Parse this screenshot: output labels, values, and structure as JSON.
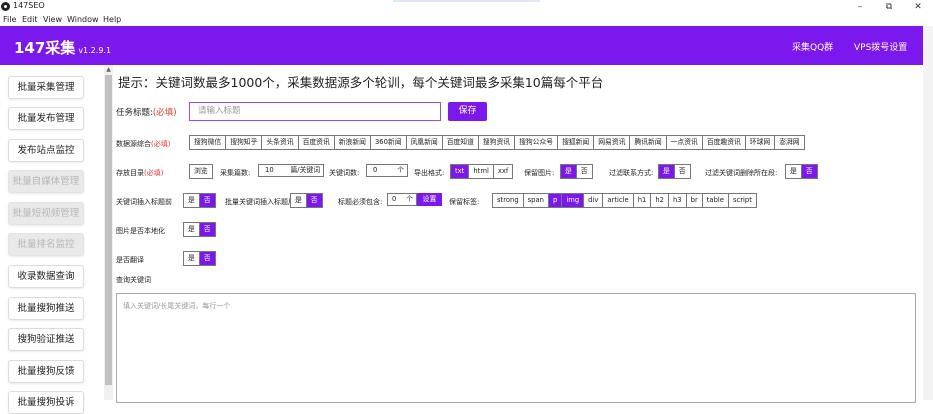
{
  "window": {
    "title": "147SEO",
    "minimize": "–",
    "maximize": "⧉",
    "close": "✕"
  },
  "menu": [
    "File",
    "Edit",
    "View",
    "Window",
    "Help"
  ],
  "header": {
    "logo": "147采集",
    "version": "v1.2.9.1",
    "links": [
      "采集QQ群",
      "VPS拨号设置"
    ]
  },
  "sidebar": {
    "items": [
      {
        "label": "批量采集管理",
        "disabled": false
      },
      {
        "label": "批量发布管理",
        "disabled": false
      },
      {
        "label": "发布站点监控",
        "disabled": false
      },
      {
        "label": "批量自媒体管理",
        "disabled": true
      },
      {
        "label": "批量短视频管理",
        "disabled": true
      },
      {
        "label": "批量排名监控",
        "disabled": true
      },
      {
        "label": "收录数据查询",
        "disabled": false
      },
      {
        "label": "批量搜狗推送",
        "disabled": false
      },
      {
        "label": "搜狗验证推送",
        "disabled": false
      },
      {
        "label": "批量搜狗反馈",
        "disabled": false
      },
      {
        "label": "批量搜狗投诉",
        "disabled": false
      }
    ]
  },
  "main": {
    "tip": "提示：关键词数最多1000个，采集数据源多个轮训，每个关键词最多采集10篇每个平台",
    "task": {
      "label": "任务标题:",
      "required": "(必填)",
      "placeholder": "请输入标题",
      "save": "保存"
    },
    "sources": {
      "label": "数据源综合",
      "required": "(必填)",
      "items": [
        "搜狗微信",
        "搜狗知乎",
        "头条资讯",
        "百度资讯",
        "新浪新闻",
        "360新闻",
        "凤凰新闻",
        "百度知道",
        "搜狗资讯",
        "搜狗公众号",
        "搜狐新闻",
        "网易资讯",
        "腾讯新闻",
        "一点资讯",
        "百度趣资讯",
        "环球网",
        "澎湃网"
      ]
    },
    "row3": {
      "dir_label": "存放目录",
      "dir_required": "(必填)",
      "browse": "浏览",
      "count_label": "采集篇数:",
      "count_value": "10",
      "count_unit": "篇/关键词",
      "kw_count_label": "关键词数:",
      "kw_count_value": "0",
      "kw_count_unit": "个",
      "export_label": "导出格式:",
      "export_formats": [
        "txt",
        "html",
        "xxf"
      ],
      "keep_img_label": "保留图片:",
      "filter_contact_label": "过滤联系方式:",
      "filter_kw_label": "过滤关键词删除所在段:",
      "yes": "是",
      "no": "否"
    },
    "row4": {
      "insert_title_label": "关键词插入标题前",
      "insert_title2_label": "批量关键词插入标题后:",
      "must_contain_label": "标题必须包含:",
      "must_contain_value": "0",
      "must_contain_unit": "个",
      "set_button": "设置",
      "keep_tags_label": "保留标签:",
      "tags": [
        "strong",
        "span",
        "p",
        "img",
        "div",
        "article",
        "h1",
        "h2",
        "h3",
        "br",
        "table",
        "script"
      ]
    },
    "localize_label": "图片是否本地化",
    "translate_label": "是否翻译",
    "query_label": "查询关键词",
    "textarea_placeholder": "填入关键词/长尾关键词，每行一个"
  },
  "colors": {
    "brand": "#7a18ee",
    "required": "#e23a2e"
  }
}
